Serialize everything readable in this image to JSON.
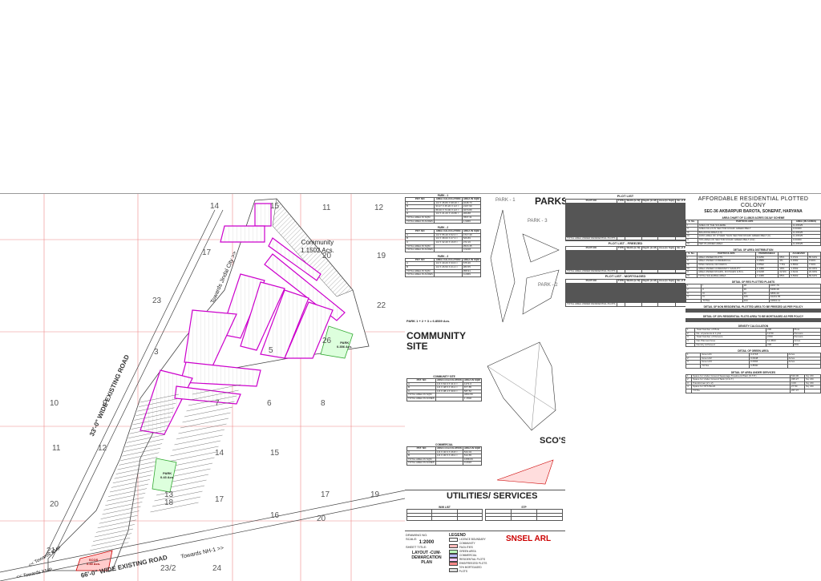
{
  "map": {
    "plot_numbers": [
      "14",
      "15",
      "11",
      "12",
      "17",
      "20",
      "19",
      "23",
      "22",
      "26",
      "3",
      "5",
      "10",
      "9",
      "7",
      "6",
      "8",
      "11",
      "12",
      "14",
      "15",
      "13",
      "17",
      "16",
      "17",
      "20",
      "19",
      "20",
      "18",
      "21",
      "24",
      "23/2"
    ],
    "roads": {
      "existing_33": "33'-0\" WIDE EXISTING ROAD",
      "existing_66": "66'-0\" WIDE EXISTING ROAD",
      "towards_jindal": "Towards Jindal City >>",
      "towards_nh1": "Towards NH-1 >>",
      "towards_kmp": "<< Towards KMP",
      "towards_kmp2": "<< Towards KMP"
    },
    "community_label": "Community",
    "community_area": "1.1502 Acs.",
    "park_label": "PARK",
    "park_area": "0.356 Acs.",
    "park2_label": "PARK",
    "park2_area": "0.43 Acs.",
    "scos_label": "SCOS",
    "scos_area": "0.49 Acs."
  },
  "panel1": {
    "parks_title": "PARKS",
    "park1": "PARK - 1",
    "park2": "PARK - 2",
    "park3": "PARK - 3",
    "park_tables": [
      {
        "title": "PARK - 1",
        "headers": [
          "PKT. NO",
          "AREA CALCULATION",
          "AREA IN SQM"
        ],
        "rows": [
          [
            "A",
            "1/2 X 45.80 X 98.20 =",
            "2248.73"
          ],
          [
            "B",
            "93.27 X 45.20 X 1/2 =",
            "2107.90"
          ],
          [
            "C",
            "88.40 X 74.00 X 1/2 =",
            "3270.80"
          ],
          [
            "D",
            "1/2 X 21.20 X 19.80 =",
            "209.88"
          ]
        ],
        "total_sqm": "TOTAL AREA IN SQM",
        "total_acres": "TOTAL AREA IN ACRES",
        "sqm": "7837.31",
        "acres": "1.9366"
      },
      {
        "title": "PARK - 2",
        "headers": [
          "PKT. NO",
          "AREA CALCULATION",
          "AREA IN SQM"
        ],
        "rows": [
          [
            "A",
            "1/2 X 55.40 X 62.0 =",
            "1717.40"
          ],
          [
            "B",
            "1/2 X 38.60 X 27.3 =",
            "526.89"
          ],
          [
            "C",
            "1/2 X 32.40 X 16.8 =",
            "272.16"
          ]
        ],
        "total_sqm": "TOTAL AREA IN SQM",
        "total_acres": "TOTAL AREA IN ACRES",
        "sqm": "2516.45",
        "acres": "0.6218"
      },
      {
        "title": "PARK - 3",
        "headers": [
          "PKT. NO",
          "AREA CALCULATION",
          "AREA IN SQM"
        ],
        "rows": [
          [
            "A",
            "1/2 X 40.20 X 33.6 =",
            "675.36"
          ],
          [
            "B",
            "1/2 X 26.50 X 21.4 =",
            "283.55"
          ]
        ],
        "total_sqm": "TOTAL AREA IN SQM",
        "total_acres": "TOTAL AREA IN ACRES",
        "sqm": "958.91",
        "acres": "0.2369"
      }
    ],
    "park_sum": "PARK 1 + 2 + 3",
    "park_sum_value": "6.8539 Acs.",
    "community_title": "COMMUNITY SITE",
    "community_table_title": "COMMUNITY SITE",
    "community_rows": [
      [
        "A",
        "1/2 X 62.0 X 41.0 =",
        "1271.0"
      ],
      [
        "B",
        "1/2 X 48.5 X 36.2 =",
        "877.85"
      ],
      [
        "C",
        "1/2 X 38.4 X 30.6 =",
        "587.52"
      ]
    ],
    "community_total": "4654.56",
    "community_acres": "1.1502",
    "commercial_table_title": "COMMERCIAL",
    "commercial_rows": [
      [
        "A",
        "1/2 X 40.6 X 26.8 =",
        "544.04"
      ],
      [
        "B",
        "1/2 X 36.5 X 28.2 =",
        "514.65"
      ]
    ],
    "commercial_total": "1058.69",
    "commercial_acres": "0.2616",
    "scos_title": "SCO'S",
    "utilities_title": "UTILITIES/ SERVICES",
    "wwl_title": "W/W LIST",
    "stp_title": "STP",
    "drawing_label": "DRAWING NO.",
    "scale_label": "SCALE:",
    "scale_value": "1:2000",
    "sheet_label": "SHEET TITLE:",
    "sheet_title": "LAYOUT -CUM- DEMARCATION PLAN",
    "legend_title": "LEGEND",
    "legend_items": [
      "LICENCE BOUNDARY",
      "COMMUNITY FACILITIES",
      "GREEN AREA",
      "COMMERCIAL",
      "RESIDENTIAL PLOTS",
      "EWS/FREEZED PLOTS",
      "70% MORTGAGED PLOTS"
    ],
    "firm_name": "SNSEL ARL"
  },
  "panel2": {
    "plot_list_title": "PLOT LIST",
    "freezed_title": "PLOT LIST - FREEZED",
    "mortgaged_title": "PLOT LIST - MORTGAGED",
    "headers": [
      "PLOT NO",
      "TYPE",
      "Width (in M)",
      "Depth (in M)",
      "Area (in Sqm)",
      "No of Plots",
      "Total Area (Sqm)"
    ],
    "total_text": "TOTAL AREA UNDER RESIDENTIAL PLOTS"
  },
  "panel3": {
    "title": "AFFORDABLE RESIDENTIAL PLOTTED COLONY",
    "subtitle": "SEC-36 AKBARPUR BAROTA, SONEPAT, HARYANA",
    "area_chart_title": "AREA CHART OF 11.45625 ACRES DDJAY SCHEME",
    "area_rows": [
      [
        "I",
        "AREA OF THE SCHEME",
        "11.45625"
      ],
      [
        "II",
        "AREA FALLS IN SECTOR ROAD/ GREEN BELT",
        "0.00000"
      ],
      [
        "III",
        "BALANCE AREA (I-II)",
        "11.45625"
      ],
      [
        "IV",
        "100% AREA OF OTHER THAN SECTOR ROAD/ GREEN BELT (II)",
        "11.45625"
      ],
      [
        "V",
        "70% AREA OF SECTOR ROAD/ GREEN BELT (II/2)",
        "0.00000"
      ],
      [
        "VI",
        "NET PLANNED AREA",
        "11.45625"
      ]
    ],
    "particulars": "PARTICULARS",
    "area_in_acres": "AREA (IN ACRES)",
    "s_no": "S. No.",
    "detail_distribution": "DETAIL OF AREA DISTRIBUTION",
    "permissible": "PERMISSIBLE",
    "achieved": "ACHIEVED",
    "dist_rows": [
      [
        "I",
        "AREA UNDER PLOTS",
        "6.9250",
        "65%",
        "6.3721",
        "55.62%"
      ],
      [
        "II",
        "AREA UNDER COMMERCIAL",
        "0.4583",
        "4%",
        "0.4582",
        "3.99%"
      ],
      [
        "III",
        "OPEN SPACE OR PARKS",
        "0.8592",
        "7.5%",
        "0.8593",
        "7.50%"
      ],
      [
        "IV",
        "AREA UNDER COMMUNITY FACILITY",
        "1.1456",
        "10%",
        "1.1502",
        "10.04%"
      ],
      [
        "V",
        "AREA UNDER ROADS, FOYAGES & B.G.",
        "2.6248",
        "22.9%",
        "2.6241",
        "22.90%"
      ],
      [
        "VI",
        "TOTAL SALEABLE AREA",
        "7.4466",
        "65%",
        "6.8302",
        "59.62%"
      ]
    ],
    "res_plots_title": "DETAIL OF RES PLOTTED PLANTS",
    "res_rows": [
      [
        "1",
        "I",
        "18",
        "2267.79"
      ],
      [
        "2",
        "II",
        "36",
        "5468.38"
      ],
      [
        "3",
        "III",
        "40",
        "4866.40"
      ],
      [
        "4",
        "IV",
        "106",
        "10231.55"
      ]
    ],
    "res_total_label": "TOTAL",
    "res_total": "200",
    "res_total_area": "22834.12",
    "frozen_title": "DETAIL OF NON RESIDENTIAL PLOTTED AREA TO BE FREEZED AS PER POLICY",
    "mortgaged_title": "DETAIL OF 15% RESIDENTIAL PLOTS AREA TO BE MORTGAGED AS PER POLICY",
    "density_title": "DENSITY CALCULATION",
    "density_rows": [
      [
        "1",
        "Total Number of Plots",
        "200",
        "Plots"
      ],
      [
        "2",
        "No. of persons in 1 plot",
        "13.50",
        "Persons"
      ],
      [
        "3",
        "Total Number of Persons",
        "2700",
        "Persons"
      ],
      [
        "4",
        "Net Planned Area",
        "11.4563",
        "Acres"
      ]
    ],
    "density_achieved": "Density Achieved",
    "density_value": "236",
    "density_unit": "PPA",
    "green_title": "DETAIL OF GREEN AREA",
    "green_rows": [
      [
        "1",
        "Green-01",
        "0.4718",
        "Acres"
      ],
      [
        "2",
        "Green-02",
        "0.0948",
        "Acres"
      ],
      [
        "3",
        "Green-03",
        "0.0994",
        "Acres"
      ]
    ],
    "green_total": "0.8590",
    "services_title": "DETAIL OF AREA UNDER SERVICES",
    "services_rows": [
      [
        "1",
        "Space for Under Ground Sewerage Treatment Plant (S.T.P.)",
        "510.00",
        "Sq. Mtr."
      ],
      [
        "2",
        "Space for Under Ground Tank (U.G.T.)",
        "335.27",
        "Sq. Mtr."
      ],
      [
        "3",
        "Transformer (2 x 2)",
        "4.00",
        "Sq. Mtr."
      ],
      [
        "4",
        "Space for NTS Booth",
        "27.50",
        "Sq. Mtr."
      ]
    ],
    "services_total": "267.37",
    "total_label": "TOTAL"
  }
}
